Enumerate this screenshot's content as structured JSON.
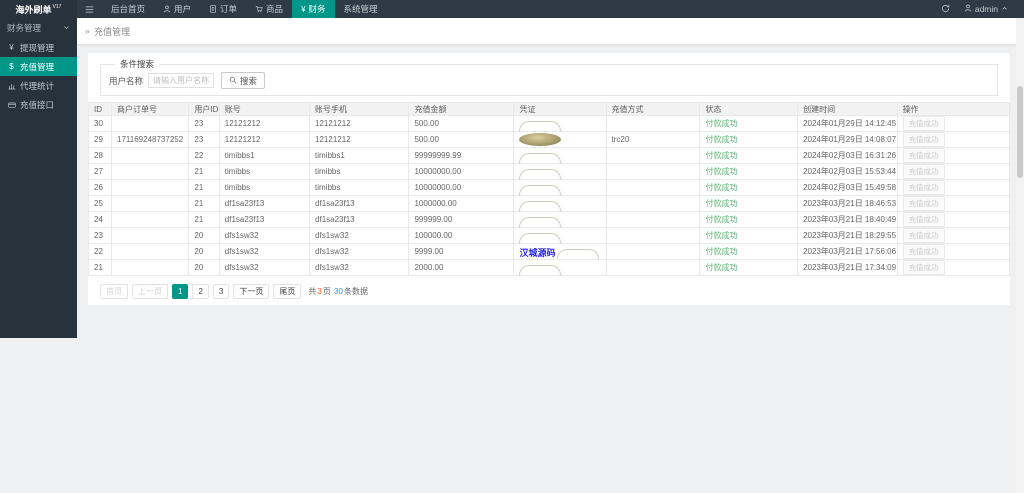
{
  "navbar": {
    "logo": "海外刷单",
    "logo_sup": "V17",
    "items": [
      {
        "name": "dashboard",
        "label": "后台首页",
        "icon": "",
        "active": false
      },
      {
        "name": "users",
        "label": "用户",
        "icon": "user",
        "active": false
      },
      {
        "name": "orders",
        "label": "订单",
        "icon": "order",
        "active": false
      },
      {
        "name": "goods",
        "label": "商品",
        "icon": "cart",
        "active": false
      },
      {
        "name": "finance",
        "label": "财务",
        "icon": "yen",
        "active": true
      },
      {
        "name": "system",
        "label": "系统管理",
        "icon": "",
        "active": false
      }
    ],
    "username": "admin"
  },
  "sidebar": {
    "section_label": "财务管理",
    "items": [
      {
        "name": "withdraw",
        "label": "提现管理",
        "icon": "yen-text",
        "active": false
      },
      {
        "name": "recharge",
        "label": "充值管理",
        "icon": "dollar-text",
        "active": true
      },
      {
        "name": "agent-stats",
        "label": "代理统计",
        "icon": "chart",
        "active": false
      },
      {
        "name": "recharge-api",
        "label": "充值接口",
        "icon": "card",
        "active": false
      }
    ]
  },
  "breadcrumb": {
    "caret": "»",
    "current": "充值管理"
  },
  "search": {
    "legend": "条件搜索",
    "label": "用户名称",
    "placeholder": "请输入用户名称",
    "button": "搜索"
  },
  "table": {
    "columns": [
      "ID",
      "商户订单号",
      "用户ID",
      "账号",
      "账号手机",
      "充值金额",
      "凭证",
      "充值方式",
      "状态",
      "创建时间",
      "操作"
    ],
    "keys": [
      "id",
      "order_no",
      "user_id",
      "account",
      "phone",
      "amount",
      "voucher",
      "method",
      "status",
      "time",
      "action"
    ],
    "status_text": "付款成功",
    "action_text": "充值成功",
    "rows": [
      {
        "id": "30",
        "order_no": "",
        "user_id": "23",
        "account": "12121212",
        "phone": "12121212",
        "amount": "500.00",
        "voucher": "arc",
        "voucher_text": "",
        "method": "",
        "time": "2024年01月29日 14:12:45"
      },
      {
        "id": "29",
        "order_no": "171169248737252",
        "user_id": "23",
        "account": "12121212",
        "phone": "12121212",
        "amount": "500.00",
        "voucher": "image",
        "voucher_text": "",
        "method": "trc20",
        "time": "2024年01月29日 14:08:07"
      },
      {
        "id": "28",
        "order_no": "",
        "user_id": "22",
        "account": "timibbs1",
        "phone": "timibbs1",
        "amount": "99999999.99",
        "voucher": "arc",
        "voucher_text": "",
        "method": "",
        "time": "2024年02月03日 16:31:26"
      },
      {
        "id": "27",
        "order_no": "",
        "user_id": "21",
        "account": "timibbs",
        "phone": "timibbs",
        "amount": "10000000.00",
        "voucher": "arc",
        "voucher_text": "",
        "method": "",
        "time": "2024年02月03日 15:53:44"
      },
      {
        "id": "26",
        "order_no": "",
        "user_id": "21",
        "account": "timibbs",
        "phone": "timibbs",
        "amount": "10000000.00",
        "voucher": "arc",
        "voucher_text": "",
        "method": "",
        "time": "2024年02月03日 15:49:58"
      },
      {
        "id": "25",
        "order_no": "",
        "user_id": "21",
        "account": "df1sa23f13",
        "phone": "df1sa23f13",
        "amount": "1000000.00",
        "voucher": "arc",
        "voucher_text": "",
        "method": "",
        "time": "2023年03月21日 18:46:53"
      },
      {
        "id": "24",
        "order_no": "",
        "user_id": "21",
        "account": "df1sa23f13",
        "phone": "df1sa23f13",
        "amount": "999999.00",
        "voucher": "arc",
        "voucher_text": "",
        "method": "",
        "time": "2023年03月21日 18:40:49"
      },
      {
        "id": "23",
        "order_no": "",
        "user_id": "20",
        "account": "dfs1sw32",
        "phone": "dfs1sw32",
        "amount": "100000.00",
        "voucher": "arc",
        "voucher_text": "",
        "method": "",
        "time": "2023年03月21日 18:29:55"
      },
      {
        "id": "22",
        "order_no": "",
        "user_id": "20",
        "account": "dfs1sw32",
        "phone": "dfs1sw32",
        "amount": "9999.00",
        "voucher": "arc",
        "voucher_text": "汉城源码",
        "method": "",
        "time": "2023年03月21日 17:56:06"
      },
      {
        "id": "21",
        "order_no": "",
        "user_id": "20",
        "account": "dfs1sw32",
        "phone": "dfs1sw32",
        "amount": "2000.00",
        "voucher": "arc",
        "voucher_text": "",
        "method": "",
        "time": "2023年03月21日 17:34:09"
      }
    ]
  },
  "pagination": {
    "buttons": [
      {
        "label": "首页",
        "type": "first",
        "disabled": true,
        "current": false
      },
      {
        "label": "上一页",
        "type": "prev",
        "disabled": true,
        "current": false
      },
      {
        "label": "1",
        "type": "page",
        "disabled": false,
        "current": true
      },
      {
        "label": "2",
        "type": "page",
        "disabled": false,
        "current": false
      },
      {
        "label": "3",
        "type": "page",
        "disabled": false,
        "current": false
      },
      {
        "label": "下一页",
        "type": "next",
        "disabled": false,
        "current": false
      },
      {
        "label": "尾页",
        "type": "last",
        "disabled": false,
        "current": false
      }
    ],
    "summary": {
      "prefix": "共",
      "total_pages": "3",
      "pages_word": "页 ",
      "total_records": "30",
      "records_word": "条数据"
    }
  },
  "colors": {
    "accent": "#009688",
    "status_green": "#5FB878",
    "navbar_bg": "#2e3a45",
    "sidebar_bg": "#28323c",
    "pages_num": "#ff5722",
    "records_num": "#1E9FFF"
  }
}
